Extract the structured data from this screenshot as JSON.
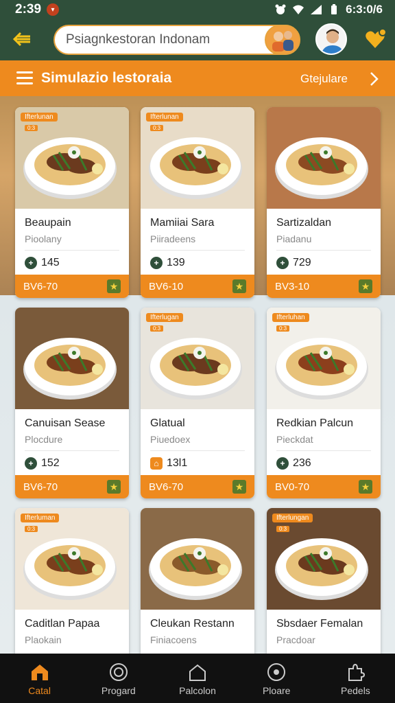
{
  "status": {
    "time": "2:39",
    "right_text": "6:3:0/6"
  },
  "search": {
    "placeholder": "Psiagnkestoran Indonam"
  },
  "title_bar": {
    "title": "Simulazio lestoraia",
    "action": "Gtejulare"
  },
  "cards": [
    {
      "tag": "Ifterlunan",
      "subtag": "0:3",
      "name": "Beaupain",
      "sub": "Pioolany",
      "count": "145",
      "price": "BV6-70",
      "count_icon": "plus-circle-icon"
    },
    {
      "tag": "Ifterlunan",
      "subtag": "0:3",
      "name": "Mamiiai Sara",
      "sub": "Piiradeens",
      "count": "139",
      "price": "BV6-10",
      "count_icon": "plus-circle-icon"
    },
    {
      "tag": "",
      "subtag": "",
      "name": "Sartizaldan",
      "sub": "Piadanu",
      "count": "729",
      "price": "BV3-10",
      "count_icon": "plus-circle-icon"
    },
    {
      "tag": "",
      "subtag": "",
      "name": "Canuisan Sease",
      "sub": "Plocdure",
      "count": "152",
      "price": "BV6-70",
      "count_icon": "plus-circle-icon"
    },
    {
      "tag": "Ifterlugan",
      "subtag": "0:3",
      "name": "Glatual",
      "sub": "Piuedoex",
      "count": "13l1",
      "price": "BV6-70",
      "count_icon": "shop-icon"
    },
    {
      "tag": "Ifterluhan",
      "subtag": "0:3",
      "name": "Redkian Palcun",
      "sub": "Pieckdat",
      "count": "236",
      "price": "BV0-70",
      "count_icon": "plus-circle-icon"
    },
    {
      "tag": "Ifterluman",
      "subtag": "0:3",
      "name": "Caditlan Papaa",
      "sub": "Plaokain",
      "count": "",
      "price": "",
      "count_icon": "plus-circle-icon"
    },
    {
      "tag": "",
      "subtag": "",
      "name": "Cleukan Restann",
      "sub": "Finiacoens",
      "count": "",
      "price": "",
      "count_icon": "plus-circle-icon"
    },
    {
      "tag": "Ifterlungan",
      "subtag": "0:3",
      "name": "Sbsdaer Femalan",
      "sub": "Pracdoar",
      "count": "",
      "price": "",
      "count_icon": "plus-circle-icon"
    }
  ],
  "nav": [
    {
      "label": "Catal",
      "icon": "home-icon",
      "active": true
    },
    {
      "label": "Progard",
      "icon": "coin-icon",
      "active": false
    },
    {
      "label": "Palcolon",
      "icon": "house-outline-icon",
      "active": false
    },
    {
      "label": "Ploare",
      "icon": "target-icon",
      "active": false
    },
    {
      "label": "Pedels",
      "icon": "puzzle-icon",
      "active": false
    }
  ],
  "colors": {
    "header": "#2f4f3a",
    "accent": "#ee8a1e",
    "nav_bg": "#111111"
  }
}
